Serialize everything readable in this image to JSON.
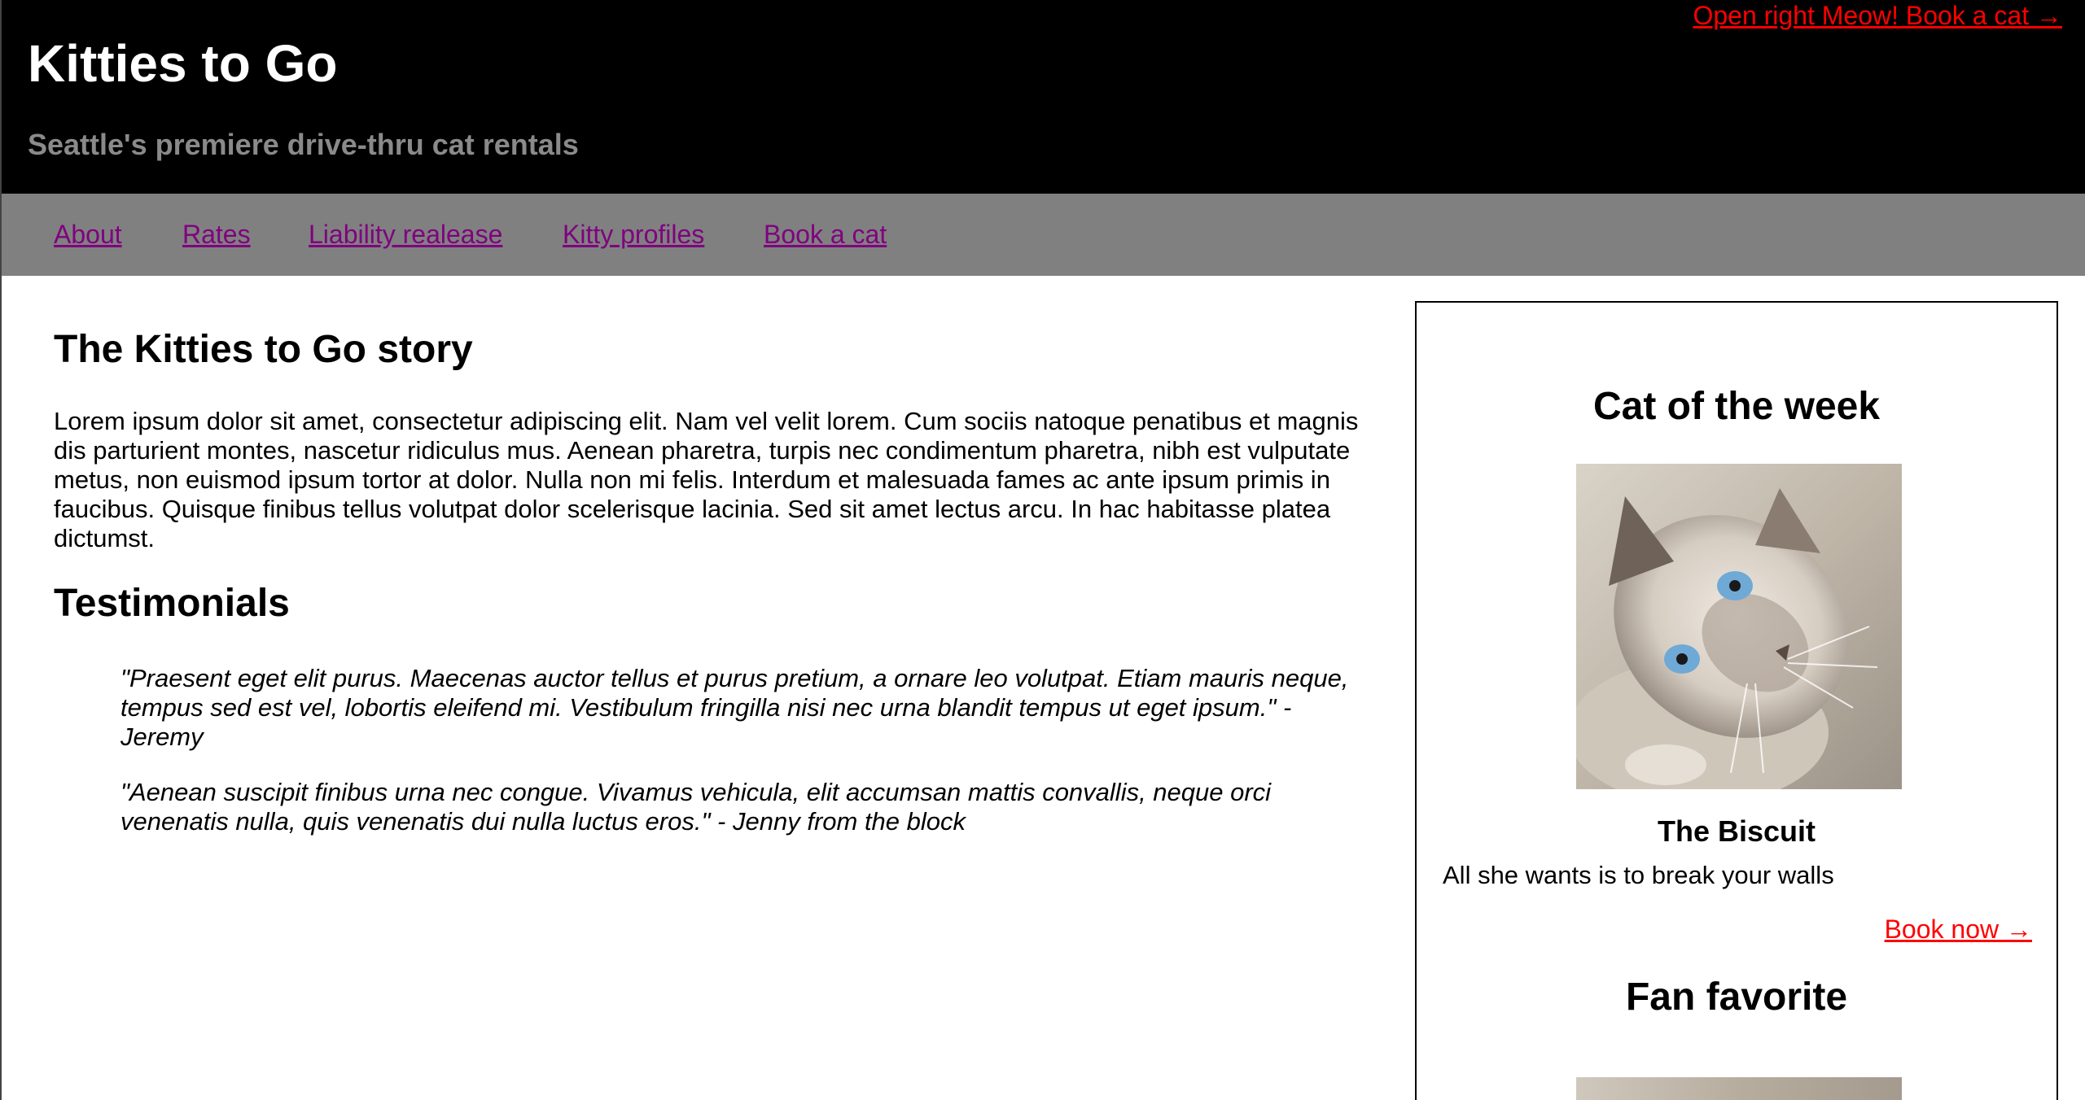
{
  "header": {
    "cta_link": "Open right Meow! Book a cat →",
    "title": "Kitties to Go",
    "tagline": "Seattle's premiere drive-thru cat rentals"
  },
  "nav": {
    "items": [
      {
        "label": "About"
      },
      {
        "label": "Rates"
      },
      {
        "label": "Liability realease"
      },
      {
        "label": "Kitty profiles"
      },
      {
        "label": "Book a cat"
      }
    ]
  },
  "main": {
    "story_title": "The Kitties to Go story",
    "story_body": "Lorem ipsum dolor sit amet, consectetur adipiscing elit. Nam vel velit lorem. Cum sociis natoque penatibus et magnis dis parturient montes, nascetur ridiculus mus. Aenean pharetra, turpis nec condimentum pharetra, nibh est vulputate metus, non euismod ipsum tortor at dolor. Nulla non mi felis. Interdum et malesuada fames ac ante ipsum primis in faucibus. Quisque finibus tellus volutpat dolor scelerisque lacinia. Sed sit amet lectus arcu. In hac habitasse platea dictumst.",
    "testimonials_title": "Testimonials",
    "testimonials": [
      {
        "text": "\"Praesent eget elit purus. Maecenas auctor tellus et purus pretium, a ornare leo volutpat. Etiam mauris neque, tempus sed est vel, lobortis eleifend mi. Vestibulum fringilla nisi nec urna blandit tempus ut eget ipsum.\" - Jeremy"
      },
      {
        "text": "\"Aenean suscipit finibus urna nec congue. Vivamus vehicula, elit accumsan mattis convallis, neque orci venenatis nulla, quis venenatis dui nulla luctus eros.\" - Jenny from the block"
      }
    ]
  },
  "sidebar": {
    "cat_of_week_title": "Cat of the week",
    "cat_name": "The Biscuit",
    "cat_description": "All she wants is to break your walls",
    "book_now": "Book now →",
    "fan_favorite_title": "Fan favorite"
  },
  "colors": {
    "header_bg": "#000000",
    "nav_bg": "#808080",
    "nav_link": "#800080",
    "cta_link": "#ff0000",
    "tagline": "#8a8a8a"
  }
}
